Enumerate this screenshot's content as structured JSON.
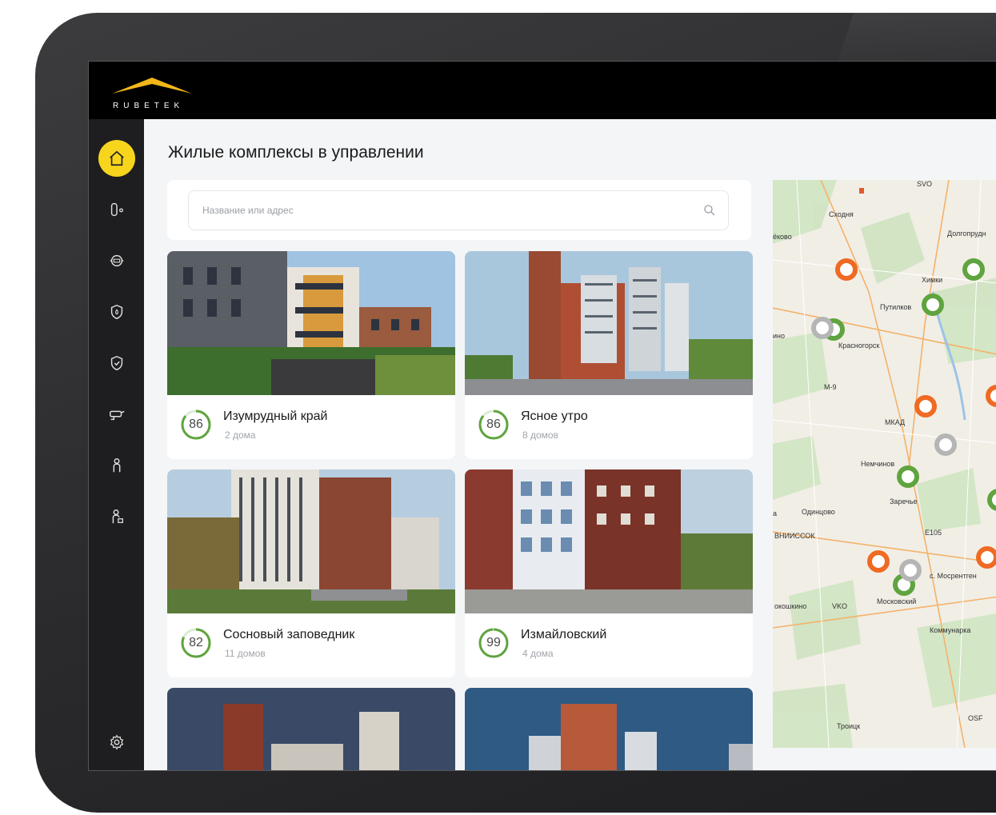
{
  "brand": {
    "logo_text": "RUBETEK",
    "accent_color": "#f7d51d"
  },
  "sidebar": {
    "items": [
      {
        "name": "home",
        "icon": "home-icon",
        "active": true
      },
      {
        "name": "keys",
        "icon": "key-icon"
      },
      {
        "name": "meters",
        "icon": "meter-icon"
      },
      {
        "name": "fire",
        "icon": "fire-shield-icon"
      },
      {
        "name": "security",
        "icon": "shield-check-icon"
      },
      {
        "name": "cameras",
        "icon": "camera-icon"
      },
      {
        "name": "residents",
        "icon": "person-icon"
      },
      {
        "name": "staff",
        "icon": "person-lock-icon"
      }
    ],
    "settings_icon": "gear-icon"
  },
  "page": {
    "title": "Жилые комплексы в управлении"
  },
  "search": {
    "placeholder": "Название или адрес"
  },
  "complexes": [
    {
      "name": "Изумрудный край",
      "houses": "2 дома",
      "score": "86",
      "score_value": 86
    },
    {
      "name": "Ясное утро",
      "houses": "8 домов",
      "score": "86",
      "score_value": 86
    },
    {
      "name": "Сосновый заповедник",
      "houses": "11 домов",
      "score": "82",
      "score_value": 82
    },
    {
      "name": "Измайловский",
      "houses": "4 дома",
      "score": "99",
      "score_value": 99
    }
  ],
  "map": {
    "labels": {
      "skhodnya": "Сходня",
      "svo": "SVO",
      "dolgoprudny": "Долгопрудн",
      "khimki": "Химки",
      "putilkovo": "Путилков",
      "krasnogorsk": "Красногорск",
      "nemchinovo": "Немчинов",
      "zarechye": "Заречье",
      "odintsovo": "Одинцово",
      "vniissok": "ВНИИССОК",
      "mosrentgen": "с. Мосрентген",
      "moskovsky": "Московский",
      "vko": "VKO",
      "kommunarka": "Коммунарка",
      "osf": "OSF",
      "troitsk": "Троицк",
      "okoshkino": "окошкино",
      "ino": "ино",
      "kovo": "ёково",
      "a": "а",
      "m9": "M-9",
      "mkad": "МКАД",
      "e105": "E105"
    },
    "colors": {
      "orange": "#ef6a23",
      "green": "#5fa43f",
      "gray": "#b5b5b5"
    }
  }
}
